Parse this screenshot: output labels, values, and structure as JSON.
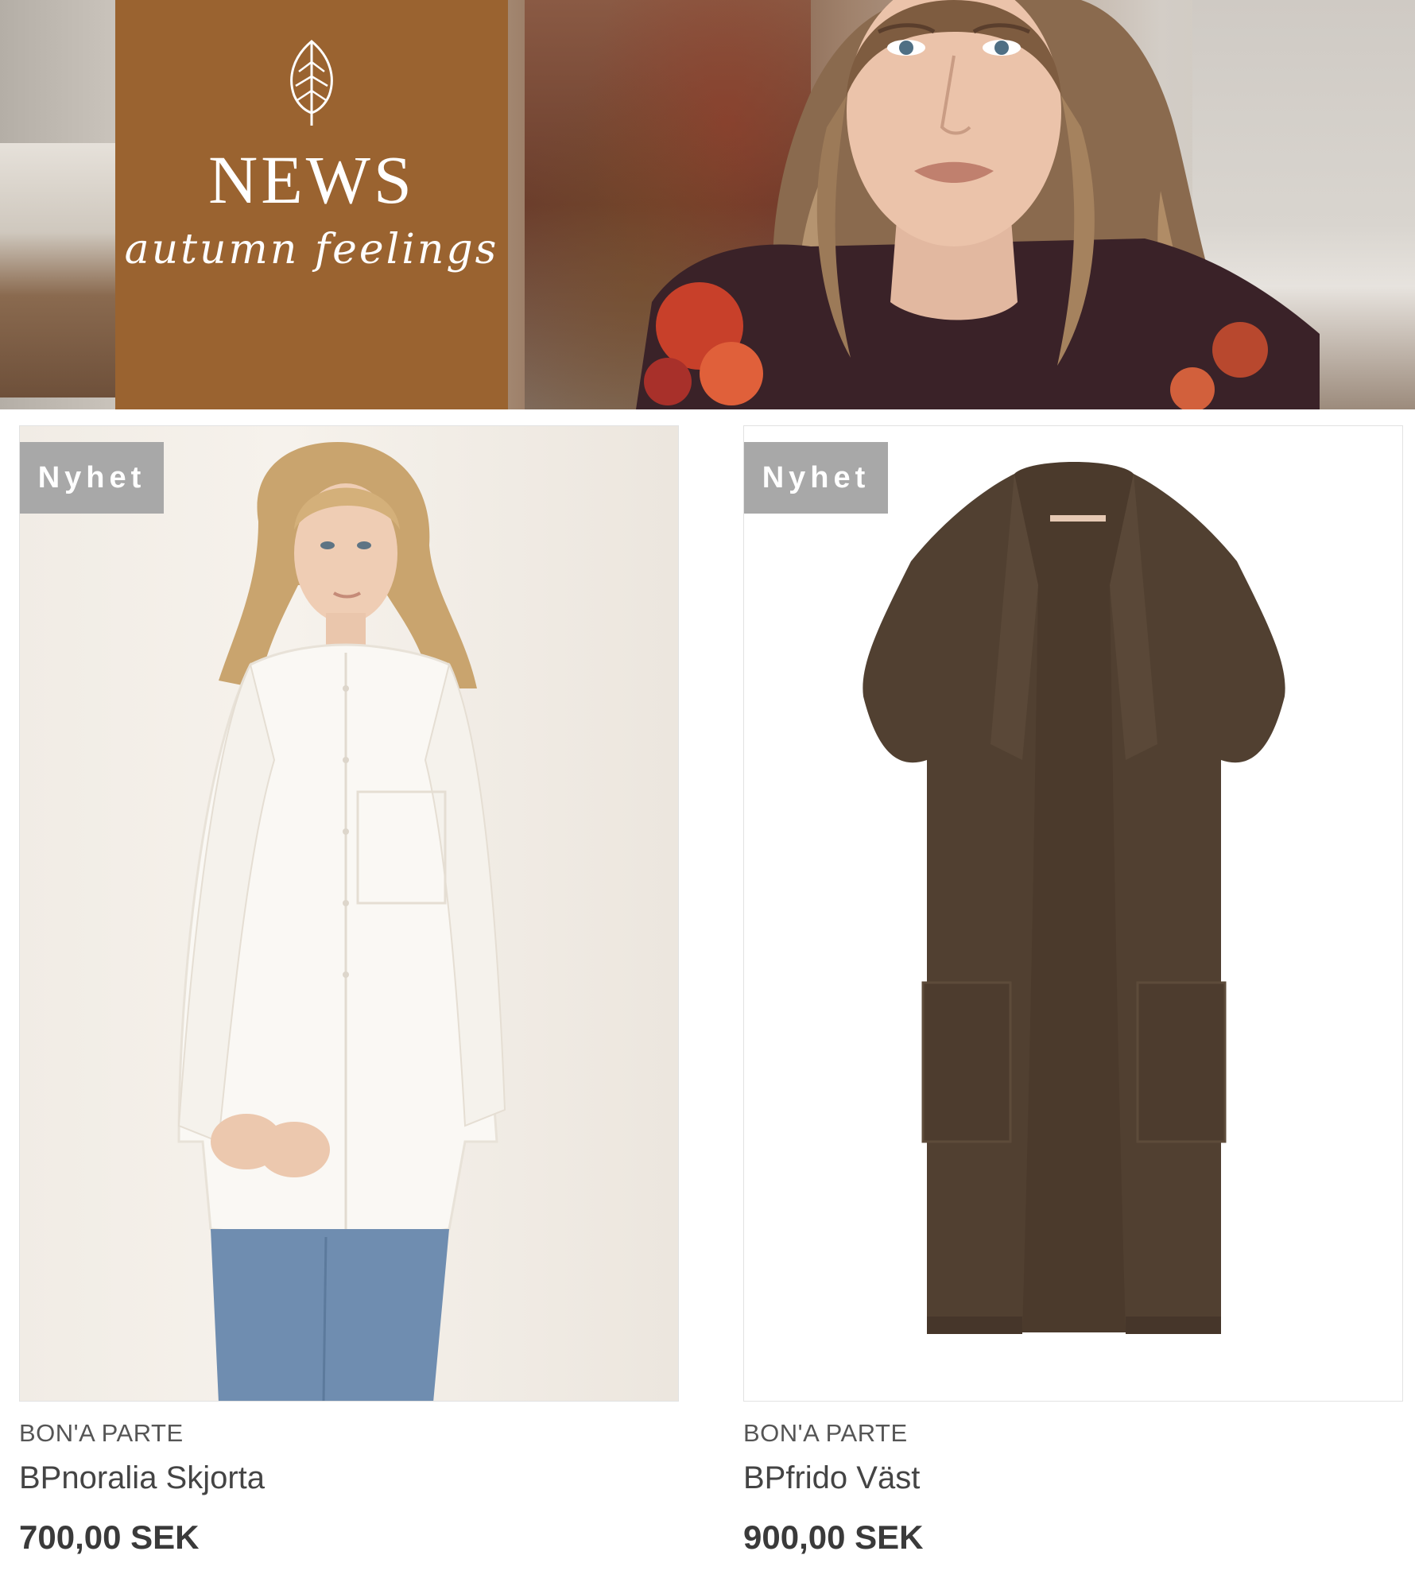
{
  "hero": {
    "title": "NEWS",
    "subtitle": "autumn feelings",
    "panel_color": "#9a6330"
  },
  "products": [
    {
      "badge": "Nyhet",
      "brand": "BON'A PARTE",
      "name": "BPnoralia Skjorta",
      "price": "700,00 SEK"
    },
    {
      "badge": "Nyhet",
      "brand": "BON'A PARTE",
      "name": "BPfrido Väst",
      "price": "900,00 SEK"
    }
  ]
}
